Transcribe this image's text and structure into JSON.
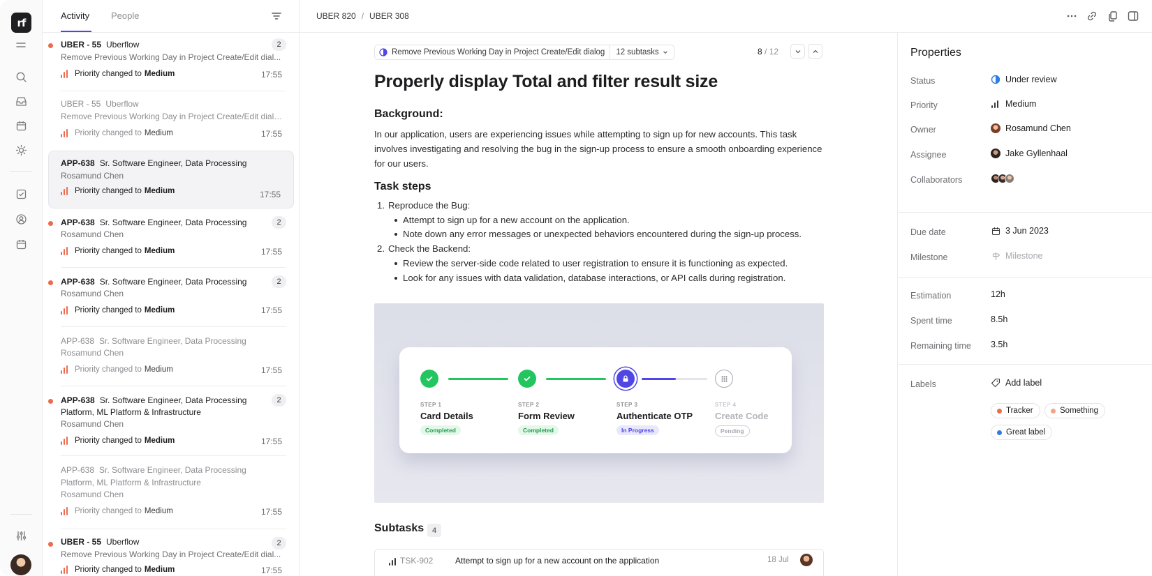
{
  "breadcrumb": {
    "first": "UBER 820",
    "second": "UBER 308"
  },
  "logo_text": "rf",
  "activity": {
    "tabs": [
      {
        "label": "Activity"
      },
      {
        "label": "People"
      }
    ],
    "items": [
      {
        "code": "UBER - 55",
        "title": "Uberflow",
        "sub": "Remove Previous Working Day in Project Create/Edit dial...",
        "sub2": "",
        "person": "",
        "change_prefix": "Priority changed to",
        "change_value": "Medium",
        "time": "17:55",
        "count": "2"
      },
      {
        "code": "UBER - 55",
        "title": "Uberflow",
        "sub": "Remove Previous Working Day in Project Create/Edit dialog",
        "sub2": "",
        "person": "",
        "change_prefix": "Priority changed to",
        "change_value": "Medium",
        "time": "17:55",
        "count": ""
      },
      {
        "code": "APP-638",
        "title": "Sr. Software Engineer, Data Processing",
        "sub": "Rosamund Chen",
        "sub2": "",
        "person": "",
        "change_prefix": "Priority changed to",
        "change_value": "Medium",
        "time": "17:55",
        "count": ""
      },
      {
        "code": "APP-638",
        "title": "Sr. Software Engineer, Data Processing",
        "sub": "Rosamund Chen",
        "sub2": "",
        "person": "",
        "change_prefix": "Priority changed to",
        "change_value": "Medium",
        "time": "17:55",
        "count": "2"
      },
      {
        "code": "APP-638",
        "title": "Sr. Software Engineer, Data Processing",
        "sub": "Rosamund Chen",
        "sub2": "",
        "person": "",
        "change_prefix": "Priority changed to",
        "change_value": "Medium",
        "time": "17:55",
        "count": "2"
      },
      {
        "code": "APP-638",
        "title": "Sr. Software Engineer, Data Processing",
        "sub": "Rosamund Chen",
        "sub2": "",
        "person": "",
        "change_prefix": "Priority changed to",
        "change_value": "Medium",
        "time": "17:55",
        "count": ""
      },
      {
        "code": "APP-638",
        "title": "Sr. Software Engineer, Data Processing",
        "sub": "Platform, ML Platform & Infrastructure",
        "sub2": "Rosamund Chen",
        "person": "",
        "change_prefix": "Priority changed to",
        "change_value": "Medium",
        "time": "17:55",
        "count": "2"
      },
      {
        "code": "APP-638",
        "title": "Sr. Software Engineer, Data Processing",
        "sub": "Platform, ML Platform & Infrastructure",
        "sub2": "Rosamund Chen",
        "person": "",
        "change_prefix": "Priority changed to",
        "change_value": "Medium",
        "time": "17:55",
        "count": ""
      },
      {
        "code": "UBER - 55",
        "title": "Uberflow",
        "sub": "Remove Previous Working Day in Project Create/Edit dial...",
        "sub2": "",
        "person": "",
        "change_prefix": "Priority changed to",
        "change_value": "Medium",
        "time": "17:55",
        "count": "2"
      }
    ]
  },
  "task": {
    "parent": "Remove Previous Working Day in Project Create/Edit dialog",
    "subtasks_dropdown": "12 subtasks",
    "pager_current": "8",
    "pager_sep": "/",
    "pager_total": "12",
    "title": "Properly display Total and filter result size",
    "background_heading": "Background:",
    "background_text": "In our application, users are experiencing issues while attempting to sign up for new accounts. This task involves investigating and resolving the bug in the sign-up process to ensure a smooth onboarding experience for our users.",
    "steps_heading": "Task steps",
    "steps": [
      {
        "num": "1.",
        "text": "Reproduce the Bug:",
        "bullets": [
          "Attempt to sign up for a new account on the application.",
          "Note down any error messages or unexpected behaviors encountered during the sign-up process."
        ]
      },
      {
        "num": "2.",
        "text": "Check the Backend:",
        "bullets": [
          "Review the server-side code related to user registration to ensure it is functioning as expected.",
          "Look for any issues with data validation, database interactions, or API calls during registration."
        ]
      }
    ],
    "image_steps": [
      {
        "label": "STEP 1",
        "name": "Card Details",
        "status": "Completed"
      },
      {
        "label": "STEP 2",
        "name": "Form Review",
        "status": "Completed"
      },
      {
        "label": "STEP 3",
        "name": "Authenticate OTP",
        "status": "In Progress"
      },
      {
        "label": "STEP 4",
        "name": "Create Code",
        "status": "Pending"
      }
    ],
    "subtasks_heading": "Subtasks",
    "subtasks_count": "4",
    "subtasks": [
      {
        "code": "TSK-902",
        "text": "Attempt to sign up for a new account on the application",
        "date": "18 Jul"
      }
    ]
  },
  "properties": {
    "heading": "Properties",
    "status": {
      "label": "Status",
      "value": "Under review"
    },
    "priority": {
      "label": "Priority",
      "value": "Medium"
    },
    "owner": {
      "label": "Owner",
      "value": "Rosamund Chen"
    },
    "assignee": {
      "label": "Assignee",
      "value": "Jake Gyllenhaal"
    },
    "collaborators": {
      "label": "Collaborators"
    },
    "due_date": {
      "label": "Due date",
      "value": "3 Jun 2023"
    },
    "milestone": {
      "label": "Milestone",
      "value": "Milestone"
    },
    "estimation": {
      "label": "Estimation",
      "value": "12h"
    },
    "spent": {
      "label": "Spent time",
      "value": "8.5h"
    },
    "remaining": {
      "label": "Remaining time",
      "value": "3.5h"
    },
    "labels": {
      "label": "Labels",
      "add": "Add label",
      "items": [
        {
          "name": "Tracker",
          "color": "#ef6a4c"
        },
        {
          "name": "Something",
          "color": "#f2a48a"
        },
        {
          "name": "Great label",
          "color": "#2f7be5"
        }
      ]
    }
  },
  "colors": {
    "accent": "#4f46e5",
    "success": "#22c55e",
    "priority": "#ef6a4c"
  }
}
